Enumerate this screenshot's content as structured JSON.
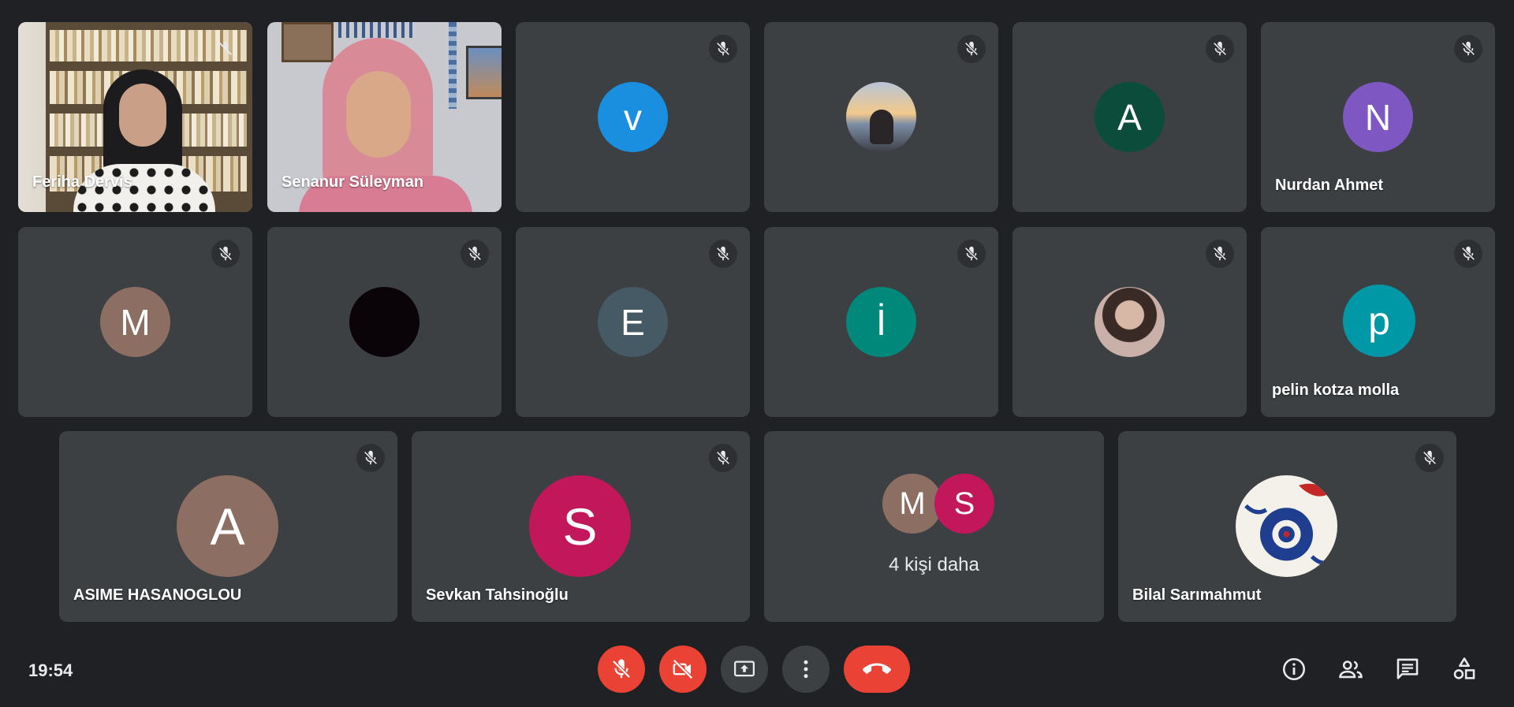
{
  "participants": [
    {
      "name": "Feriha Dervis",
      "kind": "video"
    },
    {
      "name": "Senanur Süleyman",
      "kind": "video"
    },
    {
      "initial": "v",
      "color": "#1a8fe0"
    },
    {
      "kind": "photo-sunset"
    },
    {
      "initial": "A",
      "color": "#0b4d3a"
    },
    {
      "initial": "N",
      "color": "#7e57c2",
      "name": "Nurdan Ahmet"
    },
    {
      "initial": "M",
      "color": "#8d6e63"
    },
    {
      "kind": "black-avatar",
      "color": "#0a0308"
    },
    {
      "initial": "E",
      "color": "#455a64"
    },
    {
      "initial": "İ",
      "color": "#00897b"
    },
    {
      "kind": "photo-person"
    },
    {
      "initial": "p",
      "color": "#0097a7",
      "name": "pelin kotza molla"
    },
    {
      "initial": "A",
      "color": "#8d6e63",
      "name": "ASIME HASANOGLOU"
    },
    {
      "initial": "S",
      "color": "#c2185b",
      "name": "Sevkan Tahsinoğlu"
    },
    {
      "kind": "photo-tile",
      "name": "Bilal Sarımahmut"
    }
  ],
  "overflow": {
    "avatars": [
      {
        "initial": "M",
        "color": "#8d6e63"
      },
      {
        "initial": "S",
        "color": "#c2185b"
      }
    ],
    "label": "4 kişi daha"
  },
  "toolbar": {
    "clock": "19:54",
    "mic_color": "#ea4335",
    "camera_color": "#ea4335",
    "present_color": "#3c4043",
    "more_color": "#3c4043",
    "hangup_color": "#ea4335"
  },
  "right_icons": [
    "info-icon",
    "people-icon",
    "chat-icon",
    "activities-icon"
  ]
}
